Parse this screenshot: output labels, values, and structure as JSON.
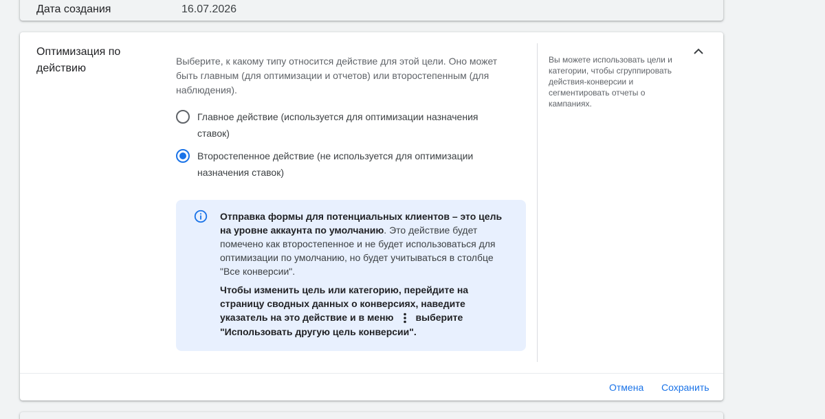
{
  "previous_card": {
    "label": "Дата создания",
    "value": "16.07.2026"
  },
  "optimization": {
    "title": "Оптимизация по действию",
    "description": "Выберите, к какому типу относится действие для этой цели. Оно может быть главным (для оптимизации и отчетов) или второстепенным (для наблюдения).",
    "options": [
      {
        "label": "Главное действие (используется для оптимизации назначения ставок)",
        "checked": false
      },
      {
        "label": "Второстепенное действие (не используется для оптимизации назначения ставок)",
        "checked": true
      }
    ],
    "info": {
      "bold_intro": "Отправка формы для потенциальных клиентов – это цель на уровне аккаунта по умолчанию",
      "text": ". Это действие будет помечено как второстепенное и не будет использоваться для оптимизации по умолчанию, но будет учитываться в столбце \"Все конверсии\".",
      "instruction_before_icon": "Чтобы изменить цель или категорию, перейдите на страницу сводных данных о конверсиях, наведите указатель на это действие и в меню",
      "instruction_after_icon": "выберите \"Использовать другую цель конверсии\"."
    },
    "side_note": "Вы можете использовать цели и категории, чтобы сгруппировать действия-конверсии и сегментировать отчеты о кампаниях.",
    "cancel_label": "Отмена",
    "save_label": "Сохранить"
  },
  "colors": {
    "accent": "#1a73e8",
    "info_background": "#e8f0fe",
    "page_background": "#f1f3f4"
  },
  "icons": [
    "info-icon",
    "more-vert-icon",
    "chevron-up-icon"
  ]
}
